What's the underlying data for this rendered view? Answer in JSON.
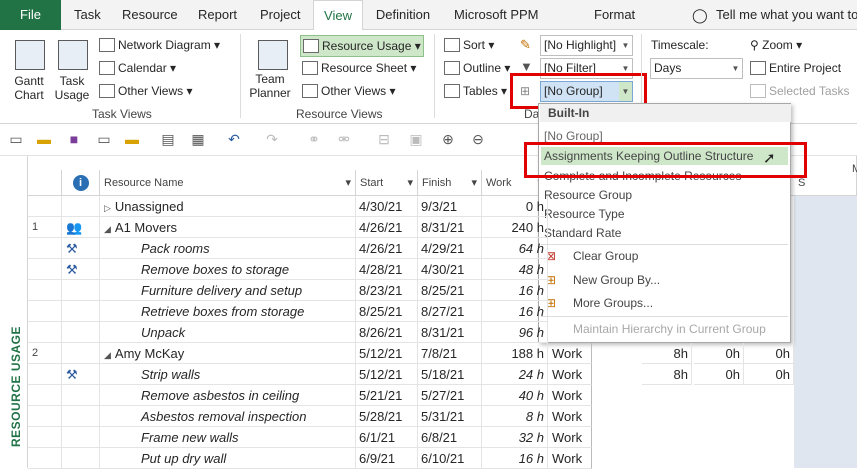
{
  "tabs": [
    "File",
    "Task",
    "Resource",
    "Report",
    "Project",
    "View",
    "Definition",
    "Microsoft PPM",
    "Format"
  ],
  "tell_me": "Tell me what you want to d",
  "ribbon": {
    "gantt_chart": "Gantt Chart",
    "task_usage": "Task Usage",
    "network_diagram": "Network Diagram",
    "calendar": "Calendar",
    "other_views": "Other Views",
    "task_views_label": "Task Views",
    "team_planner": "Team Planner",
    "resource_usage": "Resource Usage",
    "resource_sheet": "Resource Sheet",
    "other_views2": "Other Views",
    "resource_views_label": "Resource Views",
    "sort": "Sort",
    "outline": "Outline",
    "tables": "Tables",
    "highlight_value": "[No Highlight]",
    "filter_value": "[No Filter]",
    "group_value": "[No Group]",
    "data_label": "Da",
    "timescale_label": "Timescale:",
    "timescale_value": "Days",
    "zoom": "Zoom",
    "entire_project": "Entire Project",
    "selected_tasks": "Selected Tasks"
  },
  "side_label": "RESOURCE USAGE",
  "columns": {
    "name": "Resource Name",
    "start": "Start",
    "finish": "Finish",
    "work": "Work",
    "s": "S",
    "m": "M"
  },
  "rows": [
    {
      "id": "",
      "name": "Unassigned",
      "start": "4/30/21",
      "finish": "9/3/21",
      "work": "0 h",
      "type": "group",
      "icon": ""
    },
    {
      "id": "1",
      "name": "A1 Movers",
      "start": "4/26/21",
      "finish": "8/31/21",
      "work": "240 h",
      "type": "group",
      "icon": "group-icon"
    },
    {
      "id": "",
      "name": "Pack rooms",
      "start": "4/26/21",
      "finish": "4/29/21",
      "work": "64 h",
      "type": "task",
      "icon": "assignment-icon"
    },
    {
      "id": "",
      "name": "Remove boxes to storage",
      "start": "4/28/21",
      "finish": "4/30/21",
      "work": "48 h",
      "type": "task",
      "icon": "assignment-icon"
    },
    {
      "id": "",
      "name": "Furniture delivery and setup",
      "start": "8/23/21",
      "finish": "8/25/21",
      "work": "16 h",
      "type": "task",
      "icon": ""
    },
    {
      "id": "",
      "name": "Retrieve boxes from storage",
      "start": "8/25/21",
      "finish": "8/27/21",
      "work": "16 h",
      "type": "task",
      "icon": ""
    },
    {
      "id": "",
      "name": "Unpack",
      "start": "8/26/21",
      "finish": "8/31/21",
      "work": "96 h",
      "type": "task",
      "icon": ""
    },
    {
      "id": "2",
      "name": "Amy McKay",
      "start": "5/12/21",
      "finish": "7/8/21",
      "work": "188 h",
      "type": "group",
      "icon": ""
    },
    {
      "id": "",
      "name": "Strip walls",
      "start": "5/12/21",
      "finish": "5/18/21",
      "work": "24 h",
      "type": "task",
      "icon": "assignment-icon"
    },
    {
      "id": "",
      "name": "Remove asbestos in ceiling",
      "start": "5/21/21",
      "finish": "5/27/21",
      "work": "40 h",
      "type": "task",
      "icon": ""
    },
    {
      "id": "",
      "name": "Asbestos removal inspection",
      "start": "5/28/21",
      "finish": "5/31/21",
      "work": "8 h",
      "type": "task",
      "icon": ""
    },
    {
      "id": "",
      "name": "Frame new walls",
      "start": "6/1/21",
      "finish": "6/8/21",
      "work": "32 h",
      "type": "task",
      "icon": ""
    },
    {
      "id": "",
      "name": "Put up dry wall",
      "start": "6/9/21",
      "finish": "6/10/21",
      "work": "16 h",
      "type": "task",
      "icon": ""
    }
  ],
  "timephased": {
    "label": "Work",
    "row_amy": [
      "8h",
      "0h",
      "0h"
    ],
    "row_strip": [
      "8h",
      "0h",
      "0h"
    ]
  },
  "menu": {
    "header": "Built-In",
    "items": [
      "[No Group]",
      "Assignments Keeping Outline Structure",
      "Complete and Incomplete Resources",
      "Resource Group",
      "Resource Type",
      "Standard Rate"
    ],
    "clear_group": "Clear Group",
    "new_group": "New Group By...",
    "more_groups": "More Groups...",
    "maintain": "Maintain Hierarchy in Current Group"
  },
  "colors": {
    "accent": "#217346",
    "highlight": "#cfe7c9",
    "red": "#e00000"
  }
}
